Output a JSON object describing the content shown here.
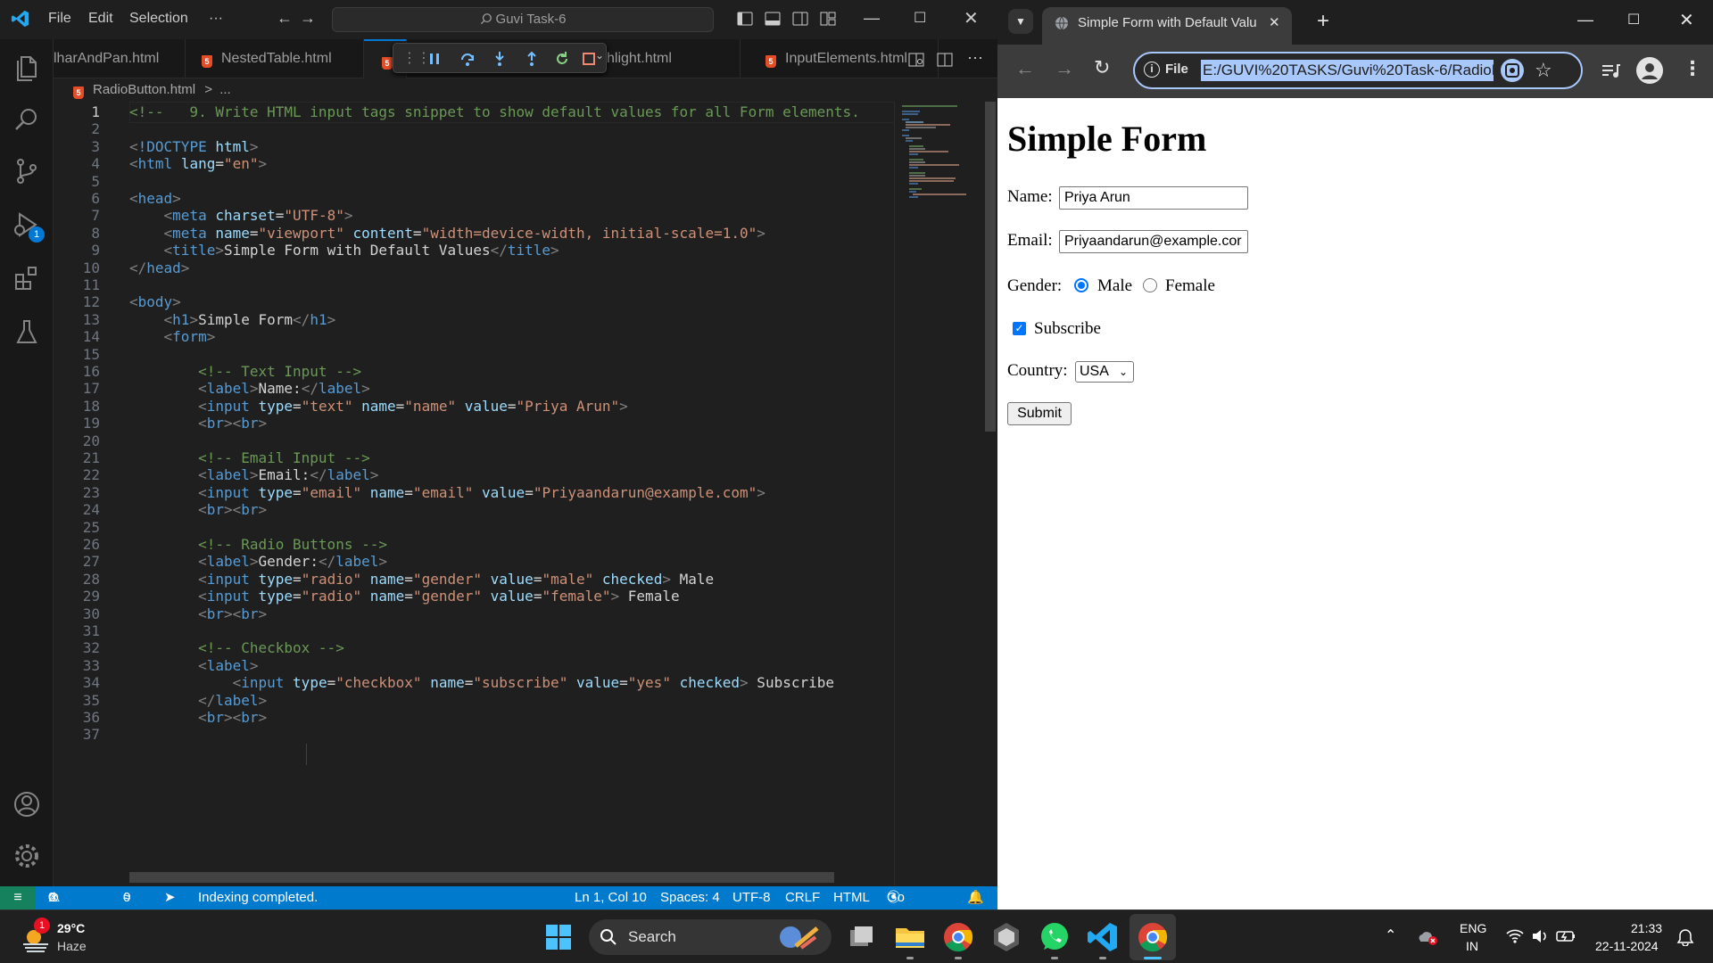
{
  "vscode": {
    "menu": [
      "File",
      "Edit",
      "Selection",
      "···"
    ],
    "command_center": "Guvi Task-6",
    "tabs": [
      {
        "label": "lharAndPan.html"
      },
      {
        "label": "NestedTable.html"
      },
      {
        "label": "hlight.html"
      },
      {
        "label": "InputElements.html"
      }
    ],
    "breadcrumb": {
      "file": "RadioButton.html",
      "sep": ">",
      "more": "..."
    },
    "run_debug_badge": "1",
    "code_lines": [
      {
        "n": "1",
        "tokens": [
          {
            "t": "cm",
            "v": "<!--   9. Write HTML input tags snippet to show default values for all Form elements."
          }
        ]
      },
      {
        "n": "2",
        "tokens": []
      },
      {
        "n": "3",
        "tokens": [
          {
            "t": "br",
            "v": "<"
          },
          {
            "t": "tag",
            "v": "!DOCTYPE"
          },
          {
            "t": "tx",
            "v": " "
          },
          {
            "t": "at",
            "v": "html"
          },
          {
            "t": "br",
            "v": ">"
          }
        ]
      },
      {
        "n": "4",
        "tokens": [
          {
            "t": "br",
            "v": "<"
          },
          {
            "t": "tag",
            "v": "html"
          },
          {
            "t": "tx",
            "v": " "
          },
          {
            "t": "at",
            "v": "lang"
          },
          {
            "t": "tx",
            "v": "="
          },
          {
            "t": "str",
            "v": "\"en\""
          },
          {
            "t": "br",
            "v": ">"
          }
        ]
      },
      {
        "n": "5",
        "tokens": []
      },
      {
        "n": "6",
        "tokens": [
          {
            "t": "br",
            "v": "<"
          },
          {
            "t": "tag",
            "v": "head"
          },
          {
            "t": "br",
            "v": ">"
          }
        ]
      },
      {
        "n": "7",
        "tokens": [
          {
            "t": "tx",
            "v": "    "
          },
          {
            "t": "br",
            "v": "<"
          },
          {
            "t": "tag",
            "v": "meta"
          },
          {
            "t": "tx",
            "v": " "
          },
          {
            "t": "at",
            "v": "charset"
          },
          {
            "t": "tx",
            "v": "="
          },
          {
            "t": "str",
            "v": "\"UTF-8\""
          },
          {
            "t": "br",
            "v": ">"
          }
        ]
      },
      {
        "n": "8",
        "tokens": [
          {
            "t": "tx",
            "v": "    "
          },
          {
            "t": "br",
            "v": "<"
          },
          {
            "t": "tag",
            "v": "meta"
          },
          {
            "t": "tx",
            "v": " "
          },
          {
            "t": "at",
            "v": "name"
          },
          {
            "t": "tx",
            "v": "="
          },
          {
            "t": "str",
            "v": "\"viewport\""
          },
          {
            "t": "tx",
            "v": " "
          },
          {
            "t": "at",
            "v": "content"
          },
          {
            "t": "tx",
            "v": "="
          },
          {
            "t": "str",
            "v": "\"width=device-width, initial-scale=1.0\""
          },
          {
            "t": "br",
            "v": ">"
          }
        ]
      },
      {
        "n": "9",
        "tokens": [
          {
            "t": "tx",
            "v": "    "
          },
          {
            "t": "br",
            "v": "<"
          },
          {
            "t": "tag",
            "v": "title"
          },
          {
            "t": "br",
            "v": ">"
          },
          {
            "t": "tx",
            "v": "Simple Form with Default Values"
          },
          {
            "t": "br",
            "v": "</"
          },
          {
            "t": "tag",
            "v": "title"
          },
          {
            "t": "br",
            "v": ">"
          }
        ]
      },
      {
        "n": "10",
        "tokens": [
          {
            "t": "br",
            "v": "</"
          },
          {
            "t": "tag",
            "v": "head"
          },
          {
            "t": "br",
            "v": ">"
          }
        ]
      },
      {
        "n": "11",
        "tokens": []
      },
      {
        "n": "12",
        "tokens": [
          {
            "t": "br",
            "v": "<"
          },
          {
            "t": "tag",
            "v": "body"
          },
          {
            "t": "br",
            "v": ">"
          }
        ]
      },
      {
        "n": "13",
        "tokens": [
          {
            "t": "tx",
            "v": "    "
          },
          {
            "t": "br",
            "v": "<"
          },
          {
            "t": "tag",
            "v": "h1"
          },
          {
            "t": "br",
            "v": ">"
          },
          {
            "t": "tx",
            "v": "Simple Form"
          },
          {
            "t": "br",
            "v": "</"
          },
          {
            "t": "tag",
            "v": "h1"
          },
          {
            "t": "br",
            "v": ">"
          }
        ]
      },
      {
        "n": "14",
        "tokens": [
          {
            "t": "tx",
            "v": "    "
          },
          {
            "t": "br",
            "v": "<"
          },
          {
            "t": "tag",
            "v": "form"
          },
          {
            "t": "br",
            "v": ">"
          }
        ]
      },
      {
        "n": "15",
        "tokens": []
      },
      {
        "n": "16",
        "tokens": [
          {
            "t": "tx",
            "v": "        "
          },
          {
            "t": "cm",
            "v": "<!-- Text Input -->"
          }
        ]
      },
      {
        "n": "17",
        "tokens": [
          {
            "t": "tx",
            "v": "        "
          },
          {
            "t": "br",
            "v": "<"
          },
          {
            "t": "tag",
            "v": "label"
          },
          {
            "t": "br",
            "v": ">"
          },
          {
            "t": "tx",
            "v": "Name:"
          },
          {
            "t": "br",
            "v": "</"
          },
          {
            "t": "tag",
            "v": "label"
          },
          {
            "t": "br",
            "v": ">"
          }
        ]
      },
      {
        "n": "18",
        "tokens": [
          {
            "t": "tx",
            "v": "        "
          },
          {
            "t": "br",
            "v": "<"
          },
          {
            "t": "tag",
            "v": "input"
          },
          {
            "t": "tx",
            "v": " "
          },
          {
            "t": "at",
            "v": "type"
          },
          {
            "t": "tx",
            "v": "="
          },
          {
            "t": "str",
            "v": "\"text\""
          },
          {
            "t": "tx",
            "v": " "
          },
          {
            "t": "at",
            "v": "name"
          },
          {
            "t": "tx",
            "v": "="
          },
          {
            "t": "str",
            "v": "\"name\""
          },
          {
            "t": "tx",
            "v": " "
          },
          {
            "t": "at",
            "v": "value"
          },
          {
            "t": "tx",
            "v": "="
          },
          {
            "t": "str",
            "v": "\"Priya Arun\""
          },
          {
            "t": "br",
            "v": ">"
          }
        ]
      },
      {
        "n": "19",
        "tokens": [
          {
            "t": "tx",
            "v": "        "
          },
          {
            "t": "br",
            "v": "<"
          },
          {
            "t": "tag",
            "v": "br"
          },
          {
            "t": "br",
            "v": "><"
          },
          {
            "t": "tag",
            "v": "br"
          },
          {
            "t": "br",
            "v": ">"
          }
        ]
      },
      {
        "n": "20",
        "tokens": []
      },
      {
        "n": "21",
        "tokens": [
          {
            "t": "tx",
            "v": "        "
          },
          {
            "t": "cm",
            "v": "<!-- Email Input -->"
          }
        ]
      },
      {
        "n": "22",
        "tokens": [
          {
            "t": "tx",
            "v": "        "
          },
          {
            "t": "br",
            "v": "<"
          },
          {
            "t": "tag",
            "v": "label"
          },
          {
            "t": "br",
            "v": ">"
          },
          {
            "t": "tx",
            "v": "Email:"
          },
          {
            "t": "br",
            "v": "</"
          },
          {
            "t": "tag",
            "v": "label"
          },
          {
            "t": "br",
            "v": ">"
          }
        ]
      },
      {
        "n": "23",
        "tokens": [
          {
            "t": "tx",
            "v": "        "
          },
          {
            "t": "br",
            "v": "<"
          },
          {
            "t": "tag",
            "v": "input"
          },
          {
            "t": "tx",
            "v": " "
          },
          {
            "t": "at",
            "v": "type"
          },
          {
            "t": "tx",
            "v": "="
          },
          {
            "t": "str",
            "v": "\"email\""
          },
          {
            "t": "tx",
            "v": " "
          },
          {
            "t": "at",
            "v": "name"
          },
          {
            "t": "tx",
            "v": "="
          },
          {
            "t": "str",
            "v": "\"email\""
          },
          {
            "t": "tx",
            "v": " "
          },
          {
            "t": "at",
            "v": "value"
          },
          {
            "t": "tx",
            "v": "="
          },
          {
            "t": "str",
            "v": "\"Priyaandarun@example.com\""
          },
          {
            "t": "br",
            "v": ">"
          }
        ]
      },
      {
        "n": "24",
        "tokens": [
          {
            "t": "tx",
            "v": "        "
          },
          {
            "t": "br",
            "v": "<"
          },
          {
            "t": "tag",
            "v": "br"
          },
          {
            "t": "br",
            "v": "><"
          },
          {
            "t": "tag",
            "v": "br"
          },
          {
            "t": "br",
            "v": ">"
          }
        ]
      },
      {
        "n": "25",
        "tokens": []
      },
      {
        "n": "26",
        "tokens": [
          {
            "t": "tx",
            "v": "        "
          },
          {
            "t": "cm",
            "v": "<!-- Radio Buttons -->"
          }
        ]
      },
      {
        "n": "27",
        "tokens": [
          {
            "t": "tx",
            "v": "        "
          },
          {
            "t": "br",
            "v": "<"
          },
          {
            "t": "tag",
            "v": "label"
          },
          {
            "t": "br",
            "v": ">"
          },
          {
            "t": "tx",
            "v": "Gender:"
          },
          {
            "t": "br",
            "v": "</"
          },
          {
            "t": "tag",
            "v": "label"
          },
          {
            "t": "br",
            "v": ">"
          }
        ]
      },
      {
        "n": "28",
        "tokens": [
          {
            "t": "tx",
            "v": "        "
          },
          {
            "t": "br",
            "v": "<"
          },
          {
            "t": "tag",
            "v": "input"
          },
          {
            "t": "tx",
            "v": " "
          },
          {
            "t": "at",
            "v": "type"
          },
          {
            "t": "tx",
            "v": "="
          },
          {
            "t": "str",
            "v": "\"radio\""
          },
          {
            "t": "tx",
            "v": " "
          },
          {
            "t": "at",
            "v": "name"
          },
          {
            "t": "tx",
            "v": "="
          },
          {
            "t": "str",
            "v": "\"gender\""
          },
          {
            "t": "tx",
            "v": " "
          },
          {
            "t": "at",
            "v": "value"
          },
          {
            "t": "tx",
            "v": "="
          },
          {
            "t": "str",
            "v": "\"male\""
          },
          {
            "t": "tx",
            "v": " "
          },
          {
            "t": "at",
            "v": "checked"
          },
          {
            "t": "br",
            "v": ">"
          },
          {
            "t": "tx",
            "v": " Male"
          }
        ]
      },
      {
        "n": "29",
        "tokens": [
          {
            "t": "tx",
            "v": "        "
          },
          {
            "t": "br",
            "v": "<"
          },
          {
            "t": "tag",
            "v": "input"
          },
          {
            "t": "tx",
            "v": " "
          },
          {
            "t": "at",
            "v": "type"
          },
          {
            "t": "tx",
            "v": "="
          },
          {
            "t": "str",
            "v": "\"radio\""
          },
          {
            "t": "tx",
            "v": " "
          },
          {
            "t": "at",
            "v": "name"
          },
          {
            "t": "tx",
            "v": "="
          },
          {
            "t": "str",
            "v": "\"gender\""
          },
          {
            "t": "tx",
            "v": " "
          },
          {
            "t": "at",
            "v": "value"
          },
          {
            "t": "tx",
            "v": "="
          },
          {
            "t": "str",
            "v": "\"female\""
          },
          {
            "t": "br",
            "v": ">"
          },
          {
            "t": "tx",
            "v": " Female"
          }
        ]
      },
      {
        "n": "30",
        "tokens": [
          {
            "t": "tx",
            "v": "        "
          },
          {
            "t": "br",
            "v": "<"
          },
          {
            "t": "tag",
            "v": "br"
          },
          {
            "t": "br",
            "v": "><"
          },
          {
            "t": "tag",
            "v": "br"
          },
          {
            "t": "br",
            "v": ">"
          }
        ]
      },
      {
        "n": "31",
        "tokens": []
      },
      {
        "n": "32",
        "tokens": [
          {
            "t": "tx",
            "v": "        "
          },
          {
            "t": "cm",
            "v": "<!-- Checkbox -->"
          }
        ]
      },
      {
        "n": "33",
        "tokens": [
          {
            "t": "tx",
            "v": "        "
          },
          {
            "t": "br",
            "v": "<"
          },
          {
            "t": "tag",
            "v": "label"
          },
          {
            "t": "br",
            "v": ">"
          }
        ]
      },
      {
        "n": "34",
        "tokens": [
          {
            "t": "tx",
            "v": "            "
          },
          {
            "t": "br",
            "v": "<"
          },
          {
            "t": "tag",
            "v": "input"
          },
          {
            "t": "tx",
            "v": " "
          },
          {
            "t": "at",
            "v": "type"
          },
          {
            "t": "tx",
            "v": "="
          },
          {
            "t": "str",
            "v": "\"checkbox\""
          },
          {
            "t": "tx",
            "v": " "
          },
          {
            "t": "at",
            "v": "name"
          },
          {
            "t": "tx",
            "v": "="
          },
          {
            "t": "str",
            "v": "\"subscribe\""
          },
          {
            "t": "tx",
            "v": " "
          },
          {
            "t": "at",
            "v": "value"
          },
          {
            "t": "tx",
            "v": "="
          },
          {
            "t": "str",
            "v": "\"yes\""
          },
          {
            "t": "tx",
            "v": " "
          },
          {
            "t": "at",
            "v": "checked"
          },
          {
            "t": "br",
            "v": ">"
          },
          {
            "t": "tx",
            "v": " Subscribe"
          }
        ]
      },
      {
        "n": "35",
        "tokens": [
          {
            "t": "tx",
            "v": "        "
          },
          {
            "t": "br",
            "v": "</"
          },
          {
            "t": "tag",
            "v": "label"
          },
          {
            "t": "br",
            "v": ">"
          }
        ]
      },
      {
        "n": "36",
        "tokens": [
          {
            "t": "tx",
            "v": "        "
          },
          {
            "t": "br",
            "v": "<"
          },
          {
            "t": "tag",
            "v": "br"
          },
          {
            "t": "br",
            "v": "><"
          },
          {
            "t": "tag",
            "v": "br"
          },
          {
            "t": "br",
            "v": ">"
          }
        ]
      },
      {
        "n": "37",
        "tokens": []
      }
    ],
    "status": {
      "problems_errors": "0",
      "problems_warnings": "0",
      "ports": "0",
      "message": "Indexing completed.",
      "position": "Ln 1, Col 10",
      "spaces": "Spaces: 4",
      "encoding": "UTF-8",
      "eol": "CRLF",
      "language": "HTML",
      "golive": "Go Live"
    }
  },
  "chrome": {
    "tab_title": "Simple Form with Default Value",
    "omnibox_chip": "File",
    "url": "E:/GUVI%20TASKS/Guvi%20Task-6/RadioBu",
    "page": {
      "heading": "Simple Form",
      "name_label": "Name:",
      "name_value": "Priya Arun",
      "email_label": "Email:",
      "email_value": "Priyaandarun@example.cor",
      "gender_label": "Gender:",
      "male_label": "Male",
      "female_label": "Female",
      "subscribe_label": "Subscribe",
      "country_label": "Country:",
      "country_value": "USA",
      "submit_label": "Submit"
    }
  },
  "taskbar": {
    "weather_temp": "29°C",
    "weather_desc": "Haze",
    "weather_badge": "1",
    "search_label": "Search",
    "lang_top": "ENG",
    "lang_bottom": "IN",
    "time": "21:33",
    "date": "22-11-2024"
  },
  "colors": {
    "vscode_bg": "#1f1f1f",
    "statusbar": "#007acc",
    "accent_blue": "#0078d4",
    "html5_orange": "#e44d26"
  }
}
